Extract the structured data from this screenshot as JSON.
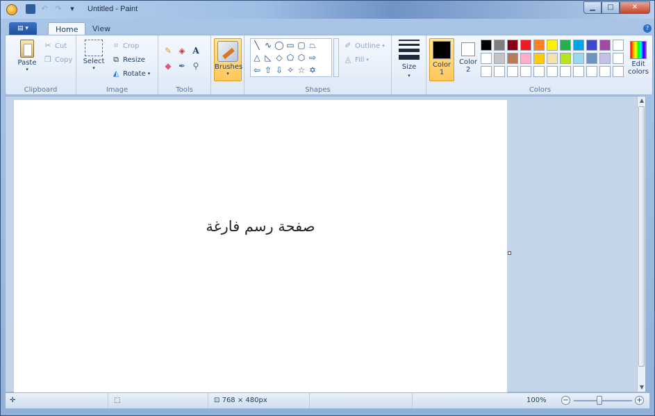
{
  "window": {
    "title": "Untitled - Paint"
  },
  "tabs": [
    {
      "label": "Home"
    },
    {
      "label": "View"
    }
  ],
  "clipboard": {
    "paste": "Paste",
    "cut": "Cut",
    "copy": "Copy",
    "group_label": "Clipboard"
  },
  "image": {
    "select": "Select",
    "crop": "Crop",
    "resize": "Resize",
    "rotate": "Rotate",
    "group_label": "Image"
  },
  "tools": {
    "group_label": "Tools",
    "text_tool": "A"
  },
  "brushes": {
    "label": "Brushes"
  },
  "shapes": {
    "outline": "Outline",
    "fill": "Fill",
    "group_label": "Shapes"
  },
  "size": {
    "label": "Size"
  },
  "colors": {
    "color1_label": "Color",
    "color1_num": "1",
    "color2_label": "Color",
    "color2_num": "2",
    "edit_label_1": "Edit",
    "edit_label_2": "colors",
    "group_label": "Colors",
    "color1_value": "#000000",
    "color2_value": "#ffffff",
    "palette_row1": [
      "#000000",
      "#7f7f7f",
      "#880015",
      "#ed1c24",
      "#ff7f27",
      "#fff200",
      "#22b14c",
      "#00a2e8",
      "#3f48cc",
      "#a349a4"
    ],
    "palette_row2": [
      "#ffffff",
      "#c3c3c3",
      "#b97a57",
      "#ffaec9",
      "#ffc90e",
      "#efe4b0",
      "#b5e61d",
      "#99d9ea",
      "#7092be",
      "#c8bfe7"
    ]
  },
  "canvas": {
    "text": "صفحة رسم فارغة"
  },
  "status": {
    "dimensions": "768 × 480px",
    "zoom": "100%"
  }
}
